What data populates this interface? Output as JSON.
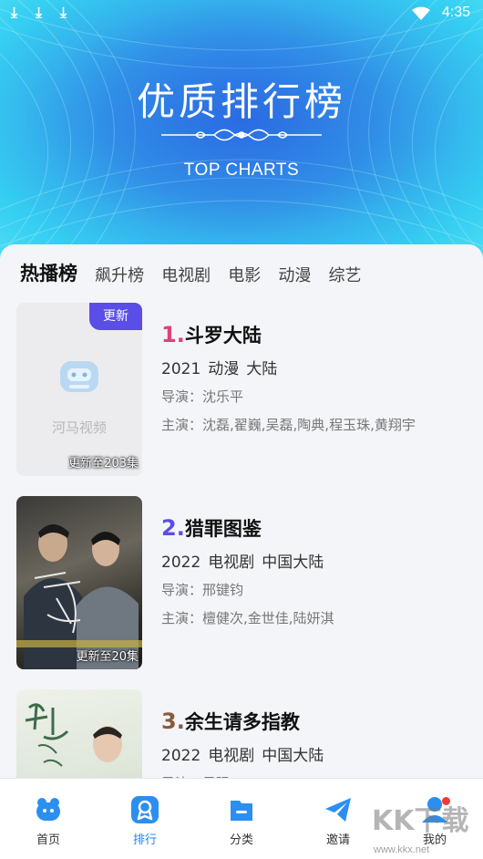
{
  "status_bar": {
    "time": "4:35",
    "download_icons": 3
  },
  "banner": {
    "title": "优质排行榜",
    "subtitle": "TOP CHARTS"
  },
  "tabs": [
    {
      "label": "热播榜",
      "active": true
    },
    {
      "label": "飙升榜",
      "active": false
    },
    {
      "label": "电视剧",
      "active": false
    },
    {
      "label": "电影",
      "active": false
    },
    {
      "label": "动漫",
      "active": false
    },
    {
      "label": "综艺",
      "active": false
    }
  ],
  "items": [
    {
      "rank": "1.",
      "rank_color": "#e0407a",
      "name": "斗罗大陆",
      "year": "2021",
      "genre": "动漫",
      "region": "大陆",
      "director": "导演：沈乐平",
      "actors": "主演：沈磊,翟巍,吴磊,陶典,程玉珠,黄翔宇",
      "poster_caption": "更新至203集",
      "badge": "更新",
      "placeholder_text": "河马视频"
    },
    {
      "rank": "2.",
      "rank_color": "#5a4de8",
      "name": "猎罪图鉴",
      "year": "2022",
      "genre": "电视剧",
      "region": "中国大陆",
      "director": "导演：邢键钧",
      "actors": "主演：檀健次,金世佳,陆妍淇",
      "poster_caption": "更新至20集"
    },
    {
      "rank": "3.",
      "rank_color": "#8a5a3a",
      "name": "余生请多指教",
      "year": "2022",
      "genre": "电视剧",
      "region": "中国大陆",
      "director": "导演：吴强",
      "actors": ""
    }
  ],
  "bottom_nav": [
    {
      "label": "首页",
      "icon": "home-icon",
      "active": false
    },
    {
      "label": "排行",
      "icon": "ranking-icon",
      "active": true
    },
    {
      "label": "分类",
      "icon": "category-icon",
      "active": false
    },
    {
      "label": "邀请",
      "icon": "invite-icon",
      "active": false
    },
    {
      "label": "我的",
      "icon": "profile-icon",
      "active": false
    }
  ],
  "watermark": {
    "text": "KK下载",
    "url": "www.kkx.net"
  },
  "colors": {
    "accent": "#1d86f0",
    "badge": "#5a4de8"
  }
}
